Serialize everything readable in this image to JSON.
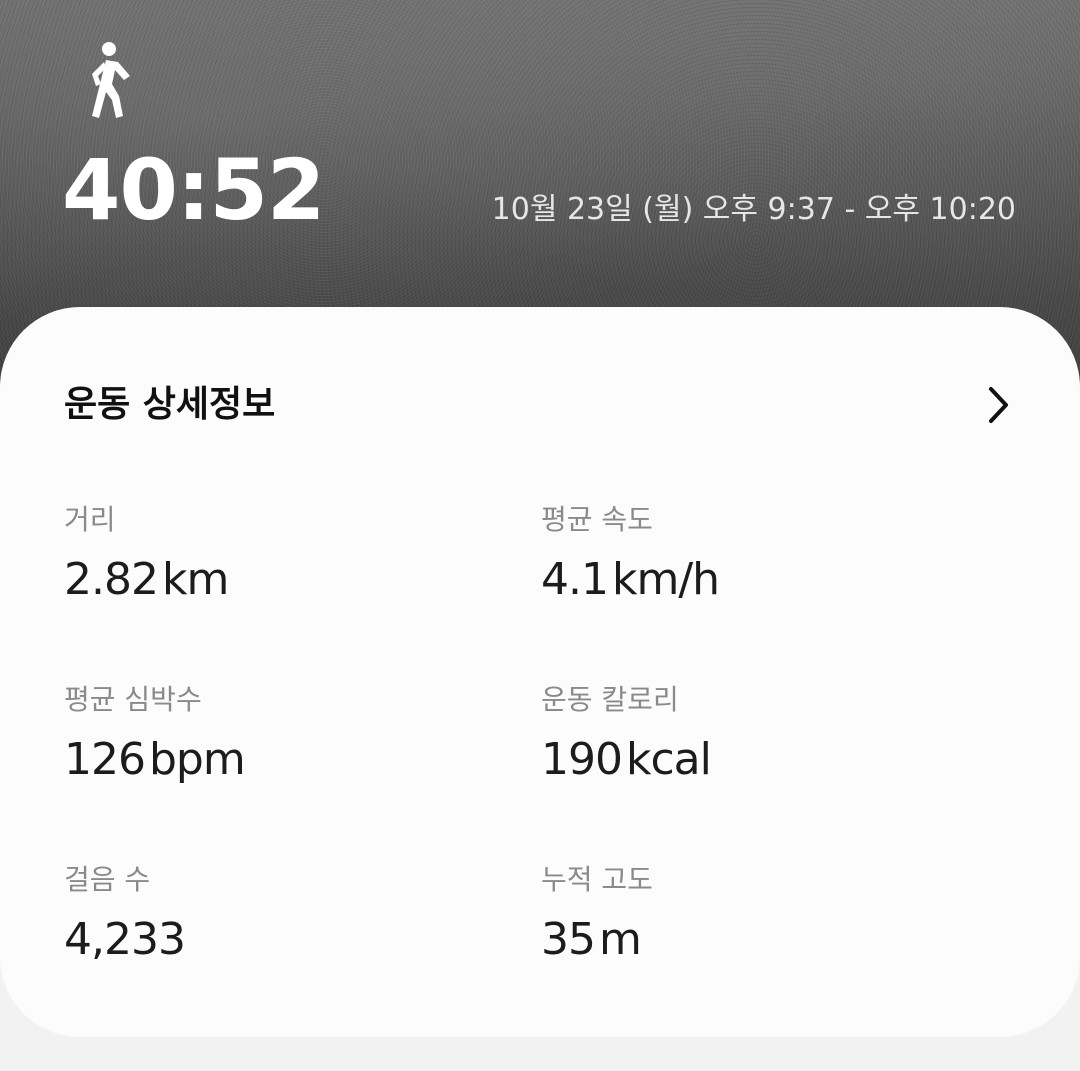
{
  "workout": {
    "activity_icon": "walking-person-icon",
    "duration": "40:52",
    "date_range": "10월 23일 (월) 오후 9:37 - 오후 10:20"
  },
  "details": {
    "title": "운동 상세정보",
    "more_icon": "chevron-right-icon",
    "stats": [
      {
        "label": "거리",
        "value": "2.82",
        "unit": "km"
      },
      {
        "label": "평균 속도",
        "value": "4.1",
        "unit": "km/h"
      },
      {
        "label": "평균 심박수",
        "value": "126",
        "unit": "bpm"
      },
      {
        "label": "운동 칼로리",
        "value": "190",
        "unit": "kcal"
      },
      {
        "label": "걸음 수",
        "value": "4,233",
        "unit": ""
      },
      {
        "label": "누적 고도",
        "value": "35",
        "unit": "m"
      }
    ]
  },
  "colors": {
    "card_background": "#fcfcfc",
    "label_text": "#8a8a8a",
    "value_text": "#1c1c1c"
  }
}
